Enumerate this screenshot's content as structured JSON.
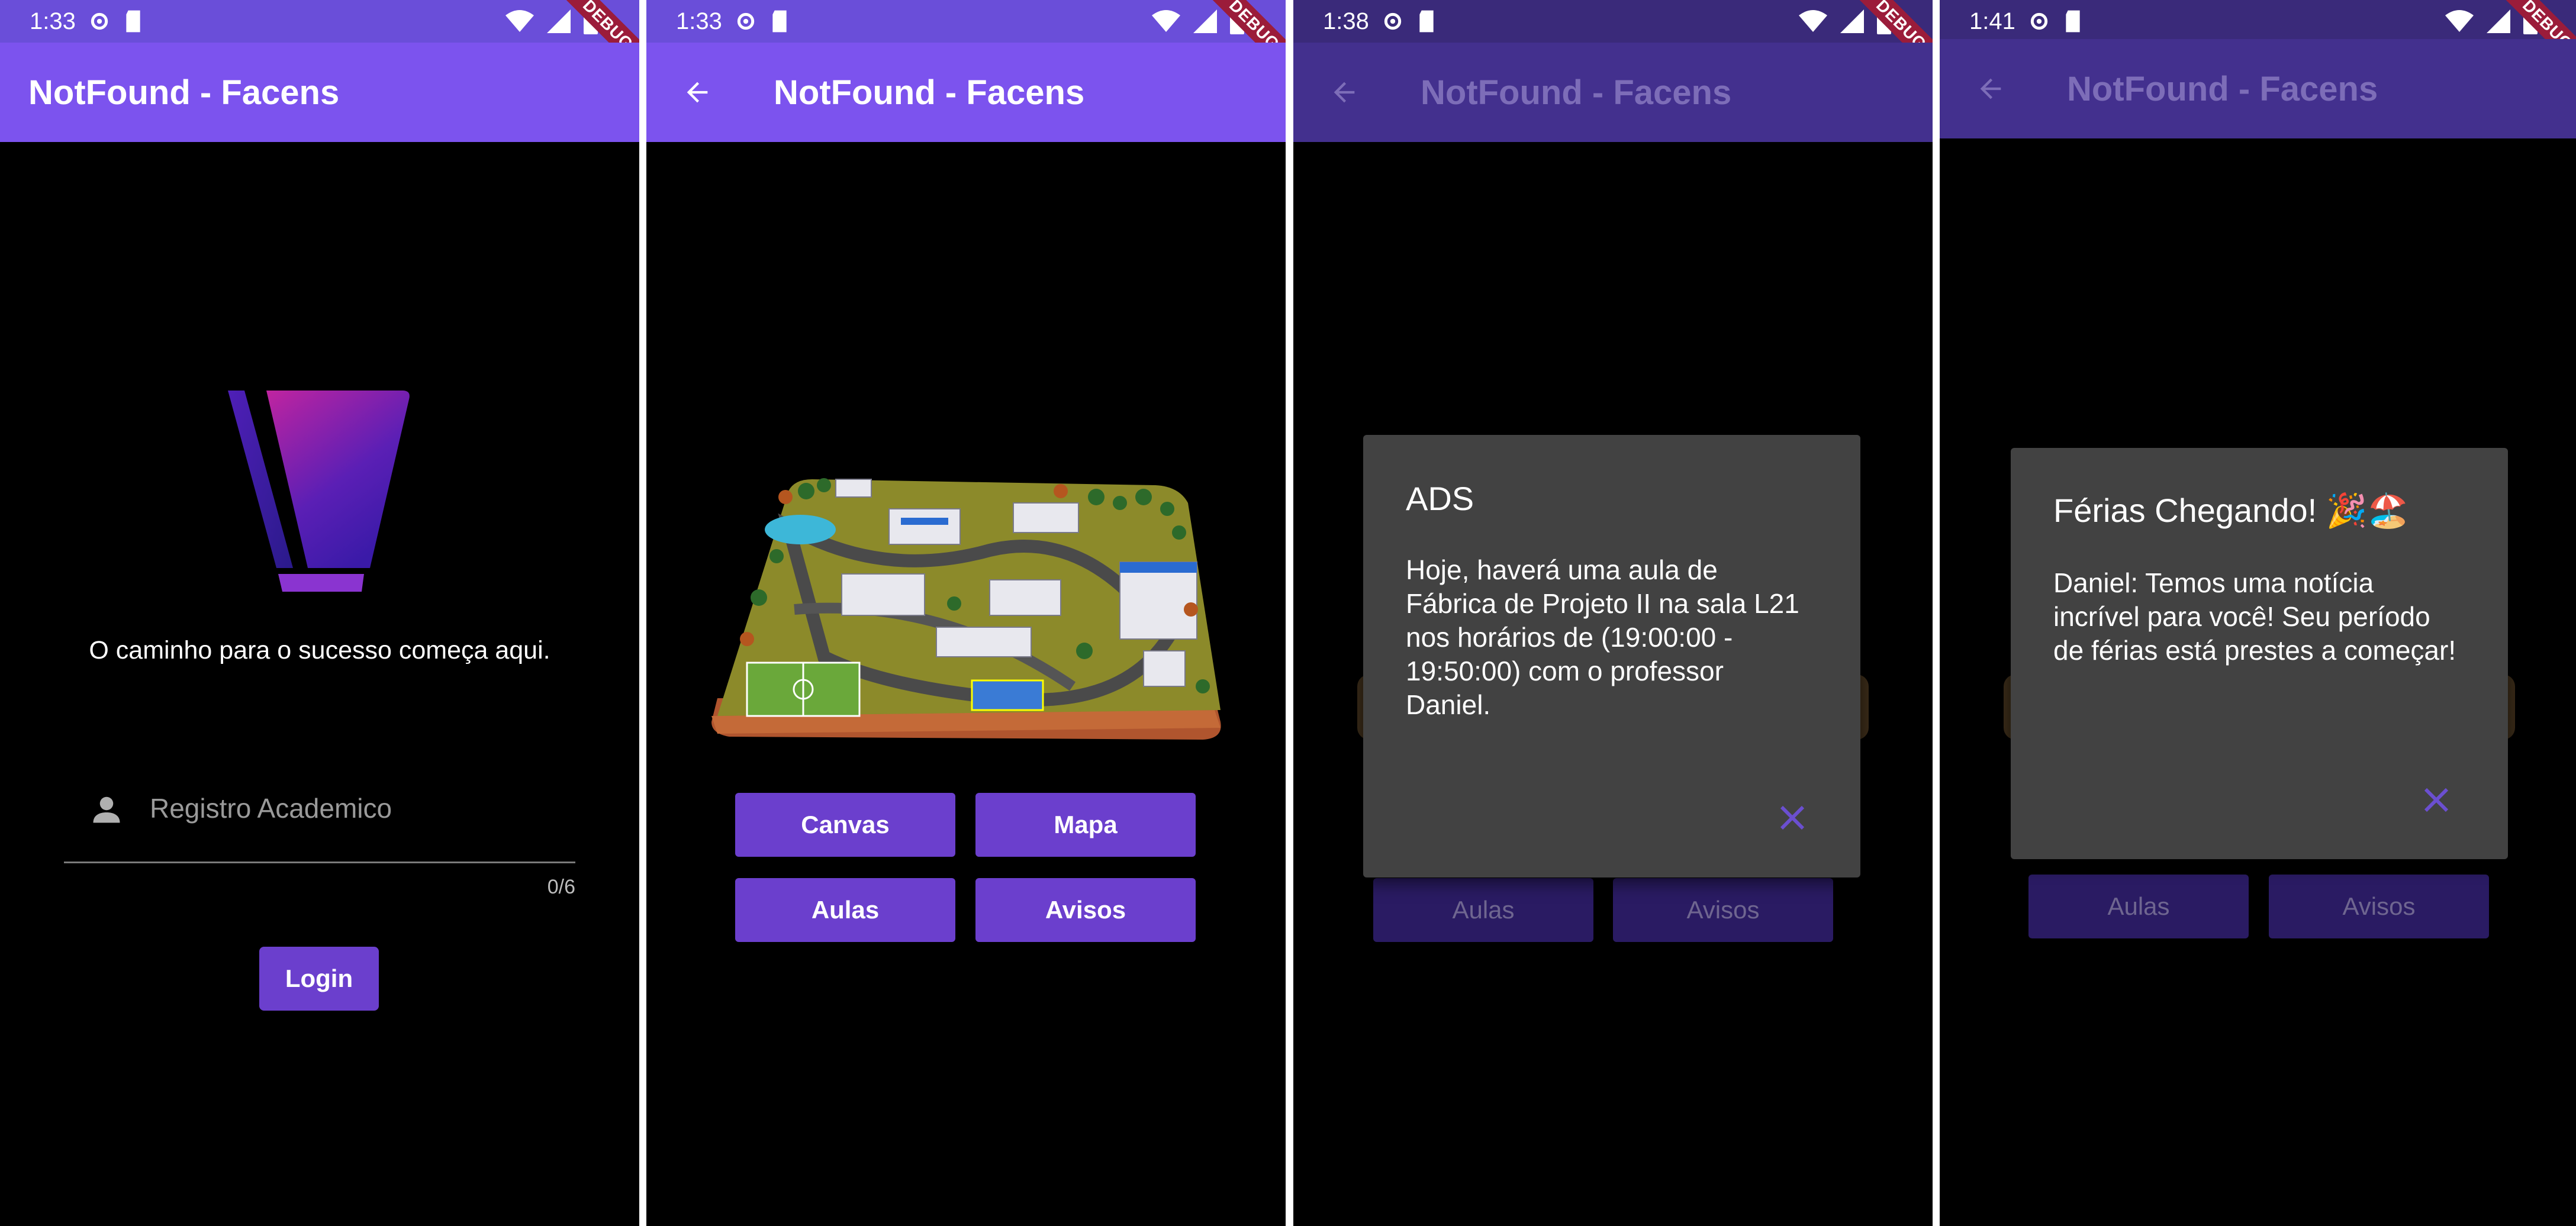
{
  "status": {
    "s1_time": "1:33",
    "s2_time": "1:33",
    "s3_time": "1:38",
    "s4_time": "1:41",
    "debug_banner": "DEBUG"
  },
  "app": {
    "title": "NotFound - Facens"
  },
  "login": {
    "tagline": "O caminho para o sucesso começa aqui.",
    "ra_placeholder": "Registro Academico",
    "ra_value": "",
    "counter": "0/6",
    "login_label": "Login"
  },
  "home": {
    "buttons": {
      "canvas": "Canvas",
      "mapa": "Mapa",
      "aulas": "Aulas",
      "avisos": "Avisos"
    },
    "campus_image": "campus-isometric-illustration"
  },
  "dialog_ads": {
    "title": "ADS",
    "body": "Hoje, haverá uma aula de Fábrica de Projeto II na sala L21 nos horários de (19:00:00 - 19:50:00) com o professor Daniel."
  },
  "dialog_ferias": {
    "title": "Férias Chegando! 🎉🏖️",
    "body": "Daniel: Temos uma notícia incrível para você! Seu período de férias está prestes a começar!"
  },
  "colors": {
    "appbar": "#7c53ee",
    "statusbar": "#6a4ed9",
    "button": "#6b3fcd",
    "dialog_bg": "#424242",
    "close_icon": "#6b4fd0"
  }
}
